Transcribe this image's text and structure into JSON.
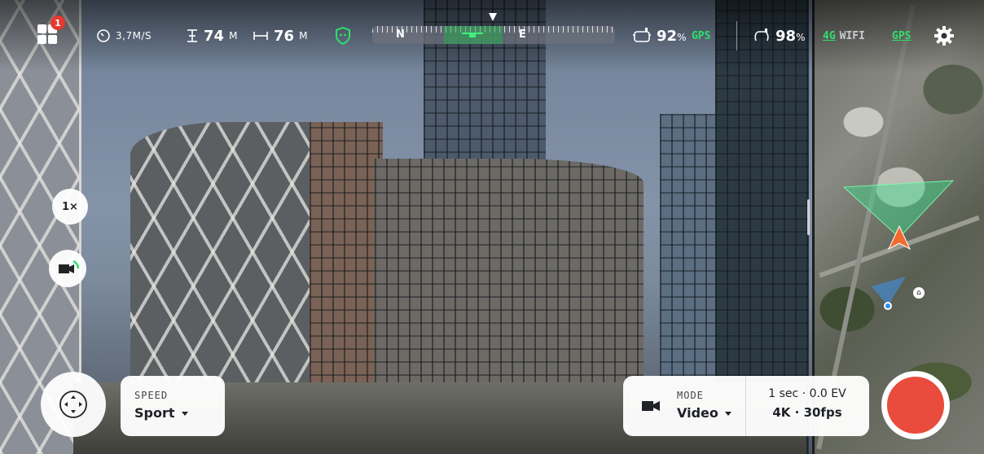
{
  "status_bar": {
    "notification_count": "1",
    "speed": "3,7M/S",
    "altitude_value": "74",
    "altitude_unit": "M",
    "distance_value": "76",
    "distance_unit": "M",
    "compass_north": "N",
    "compass_east": "E",
    "drone_battery_value": "92",
    "drone_battery_unit": "%",
    "drone_gps": "GPS",
    "controller_battery_value": "98",
    "controller_battery_unit": "%",
    "network_4g": "4G",
    "network_wifi": "WIFI",
    "phone_gps": "GPS"
  },
  "left_controls": {
    "zoom": "1×"
  },
  "speed_panel": {
    "label": "SPEED",
    "value": "Sport"
  },
  "mode_panel": {
    "label": "MODE",
    "value": "Video",
    "exposure": "1 sec · 0.0 EV",
    "resolution": "4K · 30fps"
  },
  "colors": {
    "accent_green": "#2fe06a",
    "record_red": "#e94b3c",
    "badge_red": "#e5392f",
    "drone_arrow": "#f26a2e"
  },
  "icons": [
    "menu-grid-icon",
    "speedometer-icon",
    "altitude-icon",
    "distance-icon",
    "shield-icon",
    "drone-icon",
    "controller-battery-icon",
    "drone-battery-icon",
    "settings-icon",
    "camera-switch-icon",
    "joystick-icon",
    "video-camera-icon",
    "record-icon",
    "home-icon",
    "drone-position-arrow-icon"
  ]
}
